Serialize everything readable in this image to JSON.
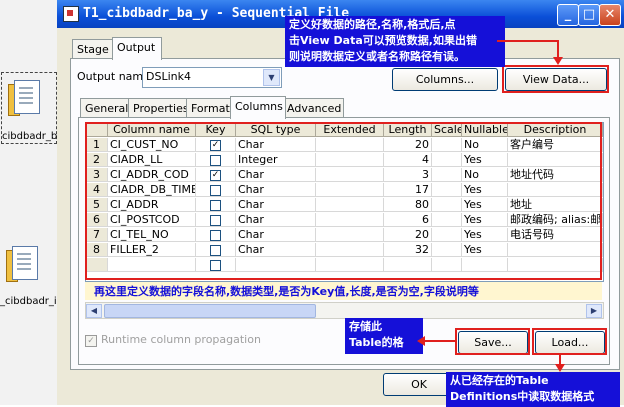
{
  "window": {
    "title": "T1_cibdbadr_ba_y - Sequential File",
    "min_glyph": "_",
    "max_glyph": "□",
    "close_glyph": "✕"
  },
  "desktop": {
    "item1_label": "cibdbadr_ba",
    "item2_label": "_cibdbadr_in"
  },
  "top_tabs": [
    "Stage",
    "Output"
  ],
  "output_name": {
    "label": "Output name:",
    "value": "DSLink4"
  },
  "buttons": {
    "columns": "Columns...",
    "view_data": "View Data...",
    "save": "Save...",
    "load": "Load...",
    "ok": "OK"
  },
  "sub_tabs": [
    "General",
    "Properties",
    "Format",
    "Columns",
    "Advanced"
  ],
  "grid": {
    "headers": [
      "",
      "Column name",
      "Key",
      "SQL type",
      "Extended",
      "Length",
      "Scale",
      "Nullable",
      "Description"
    ],
    "rows": [
      {
        "n": "1",
        "name": "CI_CUST_NO",
        "key": true,
        "type": "Char",
        "length": "20",
        "nullable": "No",
        "desc": "客户编号"
      },
      {
        "n": "2",
        "name": "CIADR_LL",
        "key": false,
        "type": "Integer",
        "length": "4",
        "nullable": "Yes",
        "desc": ""
      },
      {
        "n": "3",
        "name": "CI_ADDR_COD",
        "key": true,
        "type": "Char",
        "length": "3",
        "nullable": "No",
        "desc": "地址代码"
      },
      {
        "n": "4",
        "name": "CIADR_DB_TIME",
        "key": false,
        "type": "Char",
        "length": "17",
        "nullable": "Yes",
        "desc": ""
      },
      {
        "n": "5",
        "name": "CI_ADDR",
        "key": false,
        "type": "Char",
        "length": "80",
        "nullable": "Yes",
        "desc": "地址"
      },
      {
        "n": "6",
        "name": "CI_POSTCOD",
        "key": false,
        "type": "Char",
        "length": "6",
        "nullable": "Yes",
        "desc": "邮政编码; alias:邮"
      },
      {
        "n": "7",
        "name": "CI_TEL_NO",
        "key": false,
        "type": "Char",
        "length": "20",
        "nullable": "Yes",
        "desc": "电话号码"
      },
      {
        "n": "8",
        "name": "FILLER_2",
        "key": false,
        "type": "Char",
        "length": "32",
        "nullable": "Yes",
        "desc": ""
      }
    ]
  },
  "annotations": {
    "top_line1": "定义好数据的路径,名称,格式后,点",
    "top_line2": "击View Data可以预览数据,如果出错",
    "top_line3": "则说明数据定义或者名称路径有误。",
    "grid_note": "再这里定义数据的字段名称,数据类型,是否为Key值,长度,是否为空,字段说明等",
    "save_line1": "存储此",
    "save_line2": "Table的格",
    "load_line1": "从已经存在的Table",
    "load_line2": "Definitions中读取数据格式"
  },
  "runtime_propagation": "Runtime column propagation",
  "colors": {
    "callout_bg": "#1510d8",
    "annotation_red": "#e0201e",
    "titlebar_blue": "#0a4fd8"
  }
}
